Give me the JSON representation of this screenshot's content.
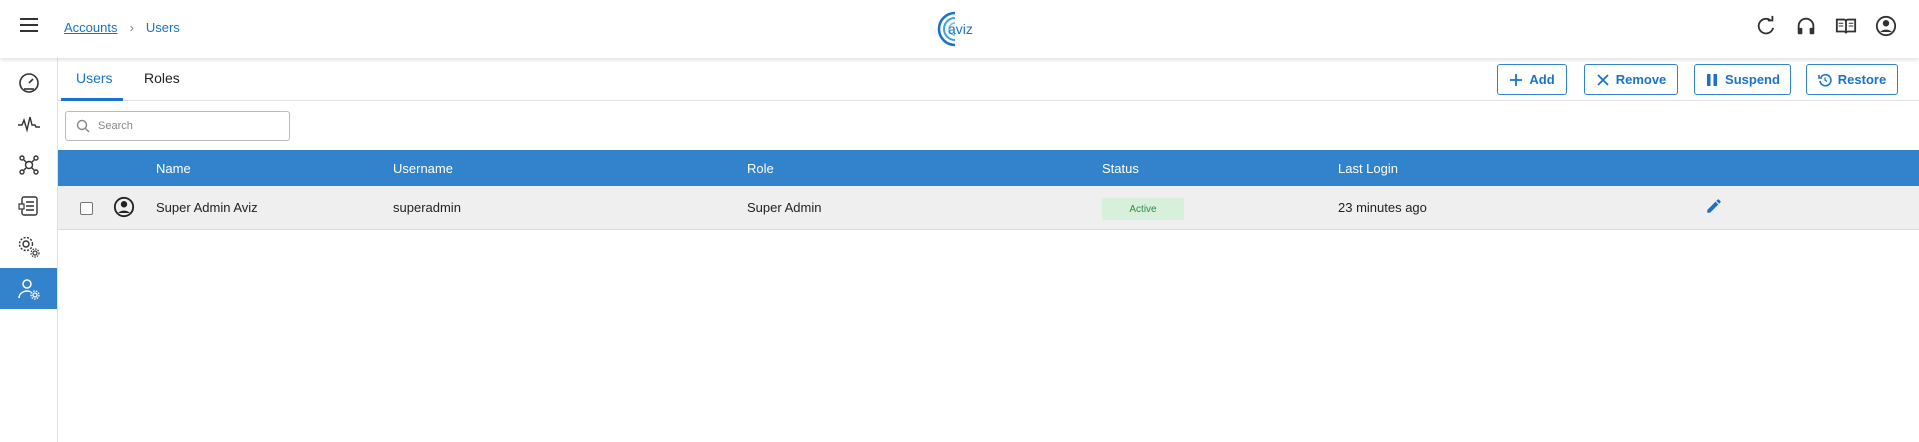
{
  "breadcrumb": {
    "parent": "Accounts",
    "separator": "›",
    "current": "Users"
  },
  "logo": {
    "text": "aviz",
    "color": "#1a73c8"
  },
  "top_icons": [
    "refresh-icon",
    "headset-icon",
    "book-icon",
    "account-circle-icon"
  ],
  "sidebar": {
    "items": [
      {
        "name": "dashboard",
        "icon": "speedometer-icon"
      },
      {
        "name": "monitoring",
        "icon": "pulse-icon"
      },
      {
        "name": "network",
        "icon": "network-icon"
      },
      {
        "name": "inventory",
        "icon": "list-document-icon"
      },
      {
        "name": "settings",
        "icon": "gears-icon"
      },
      {
        "name": "accounts",
        "icon": "user-settings-icon",
        "active": true
      }
    ]
  },
  "tabs": [
    {
      "label": "Users",
      "active": true
    },
    {
      "label": "Roles",
      "active": false
    }
  ],
  "actions": {
    "add": "Add",
    "remove": "Remove",
    "suspend": "Suspend",
    "restore": "Restore"
  },
  "search": {
    "placeholder": "Search"
  },
  "table": {
    "columns": [
      "Name",
      "Username",
      "Role",
      "Status",
      "Last Login"
    ],
    "rows": [
      {
        "name": "Super Admin Aviz",
        "username": "superadmin",
        "role": "Super Admin",
        "status": "Active",
        "last_login": "23 minutes ago"
      }
    ]
  },
  "colors": {
    "accent": "#3382cc",
    "link": "#1a73c8",
    "status_active_bg": "#d6f0dc",
    "status_active_text": "#2e8b46"
  }
}
